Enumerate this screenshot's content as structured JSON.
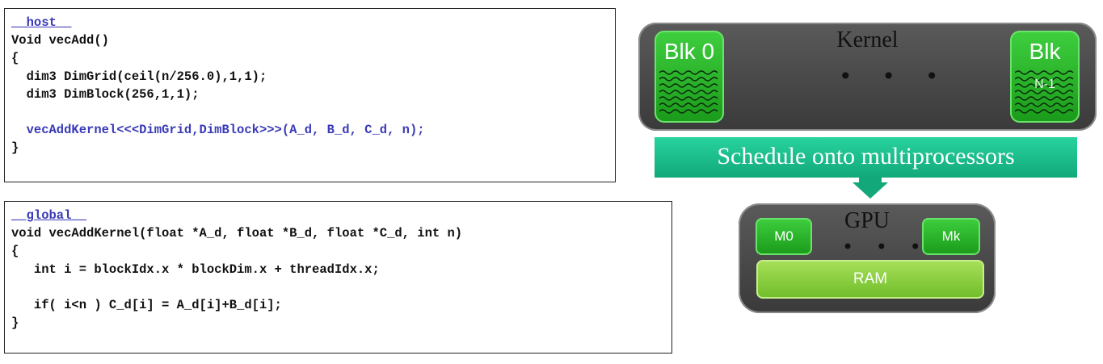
{
  "host_code": {
    "qualifier": "__host__",
    "lines": [
      "Void vecAdd()",
      "{",
      "  dim3 DimGrid(ceil(n/256.0),1,1);",
      "  dim3 DimBlock(256,1,1);",
      "",
      "  vecAddKernel<<<DimGrid,DimBlock>>>(A_d, B_d, C_d, n);",
      "}"
    ]
  },
  "global_code": {
    "qualifier": "__global__",
    "lines": [
      "void vecAddKernel(float *A_d, float *B_d, float *C_d, int n)",
      "{",
      "   int i = blockIdx.x * blockDim.x + threadIdx.x;",
      "",
      "   if( i<n ) C_d[i] = A_d[i]+B_d[i];",
      "}"
    ]
  },
  "kernel": {
    "title": "Kernel",
    "dots": "• • •",
    "block_first": "Blk 0",
    "block_last": "Blk",
    "block_last_sub": "N-1"
  },
  "schedule_label": "Schedule onto multiprocessors",
  "gpu": {
    "title": "GPU",
    "dots": "• • •",
    "m_first": "M0",
    "m_last": "Mk",
    "ram": "RAM"
  },
  "colors": {
    "code_keyword": "#3a3ab8",
    "green_block": "#1a9a1a",
    "arrow": "#12a87a",
    "panel": "#3a3a3a",
    "ram": "#6fbd2a"
  }
}
